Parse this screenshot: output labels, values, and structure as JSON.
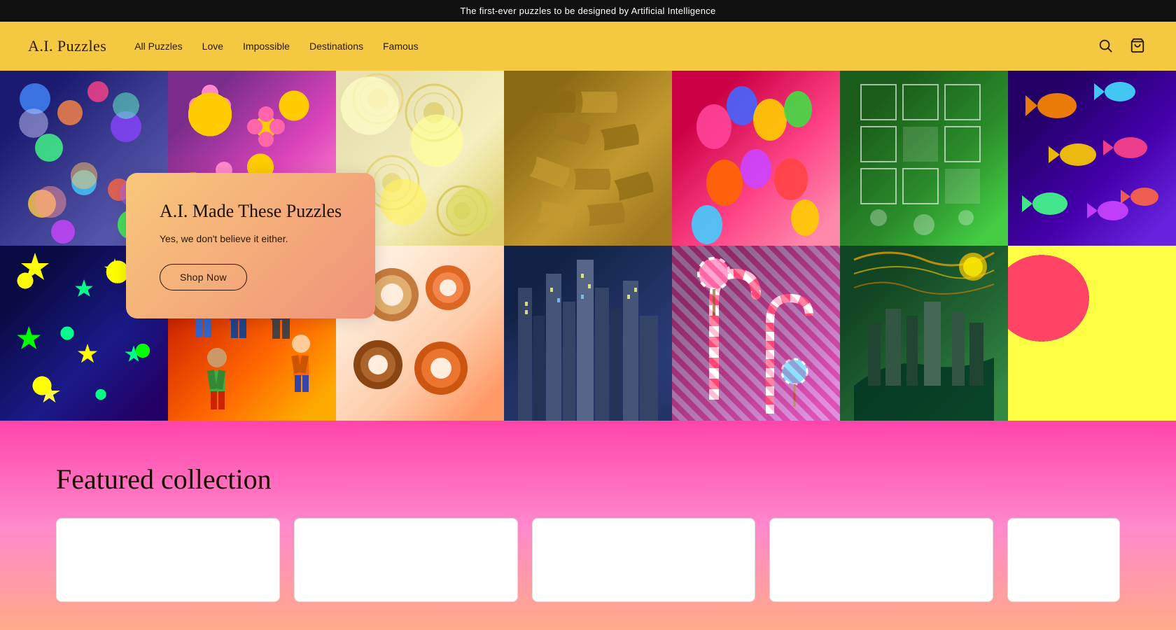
{
  "announcement": {
    "text": "The first-ever puzzles to be designed by Artificial Intelligence"
  },
  "header": {
    "logo": "A.I. Puzzles",
    "nav": [
      {
        "label": "All Puzzles",
        "id": "all-puzzles"
      },
      {
        "label": "Love",
        "id": "love"
      },
      {
        "label": "Impossible",
        "id": "impossible"
      },
      {
        "label": "Destinations",
        "id": "destinations"
      },
      {
        "label": "Famous",
        "id": "famous"
      }
    ]
  },
  "hero": {
    "card": {
      "title": "A.I. Made These Puzzles",
      "subtitle": "Yes, we don't believe it either.",
      "cta": "Shop Now"
    }
  },
  "featured": {
    "title": "Featured collection"
  },
  "puzzle_cells_top": [
    {
      "theme": "marbles",
      "label": "marbles puzzle"
    },
    {
      "theme": "flowers",
      "label": "flowers puzzle"
    },
    {
      "theme": "circles",
      "label": "circles puzzle"
    },
    {
      "theme": "puzzle-pieces",
      "label": "puzzle pieces"
    },
    {
      "theme": "balloons",
      "label": "balloons puzzle"
    },
    {
      "theme": "puzzle-white",
      "label": "white puzzle"
    },
    {
      "theme": "fish",
      "label": "fish puzzle"
    }
  ],
  "puzzle_cells_bottom": [
    {
      "theme": "stars",
      "label": "stars puzzle"
    },
    {
      "theme": "people",
      "label": "people puzzle"
    },
    {
      "theme": "donuts",
      "label": "donuts puzzle"
    },
    {
      "theme": "city",
      "label": "city puzzle"
    },
    {
      "theme": "candy",
      "label": "candy puzzle"
    },
    {
      "theme": "painting",
      "label": "painting puzzle"
    },
    {
      "theme": "watermelon",
      "label": "watermelon puzzle"
    }
  ]
}
